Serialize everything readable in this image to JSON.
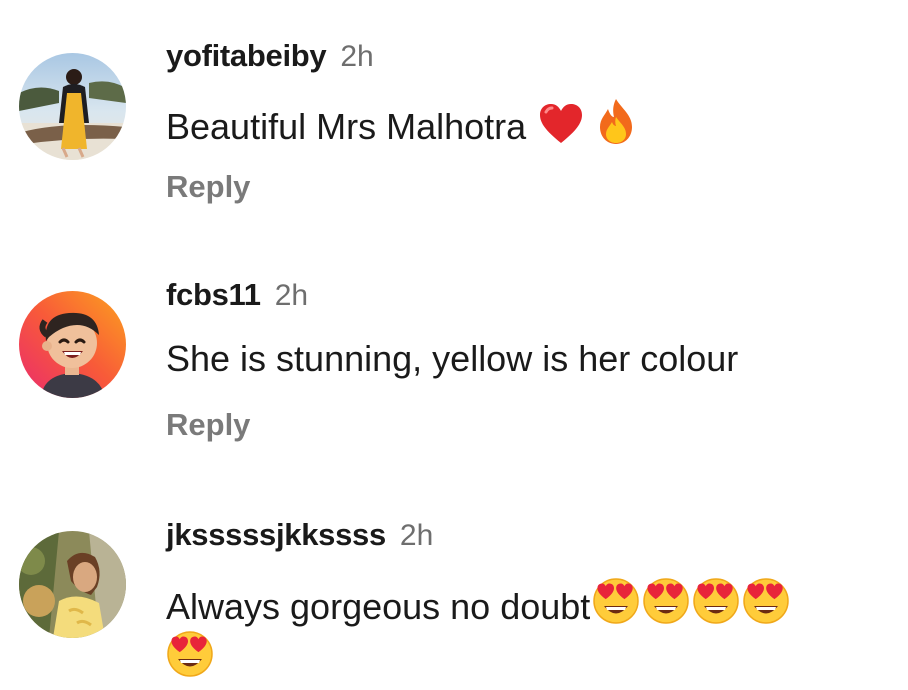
{
  "comments": [
    {
      "username": "yofitabeiby",
      "time": "2h",
      "text": "Beautiful Mrs Malhotra",
      "emojis": [
        "red-heart-emoji",
        "fire-emoji"
      ],
      "reply_label": "Reply"
    },
    {
      "username": "fcbs11",
      "time": "2h",
      "text": "She is stunning, yellow is her colour",
      "emojis": [],
      "reply_label": "Reply"
    },
    {
      "username": "jksssssjkkssss",
      "time": "2h",
      "text": "Always gorgeous no doubt",
      "emojis": [
        "heart-eyes-emoji",
        "heart-eyes-emoji",
        "heart-eyes-emoji",
        "heart-eyes-emoji",
        "heart-eyes-emoji"
      ],
      "reply_label": ""
    }
  ],
  "colors": {
    "username": "#1a1a1a",
    "timestamp": "#6e6e6e",
    "reply": "#7a7a7a",
    "background": "#ffffff"
  }
}
